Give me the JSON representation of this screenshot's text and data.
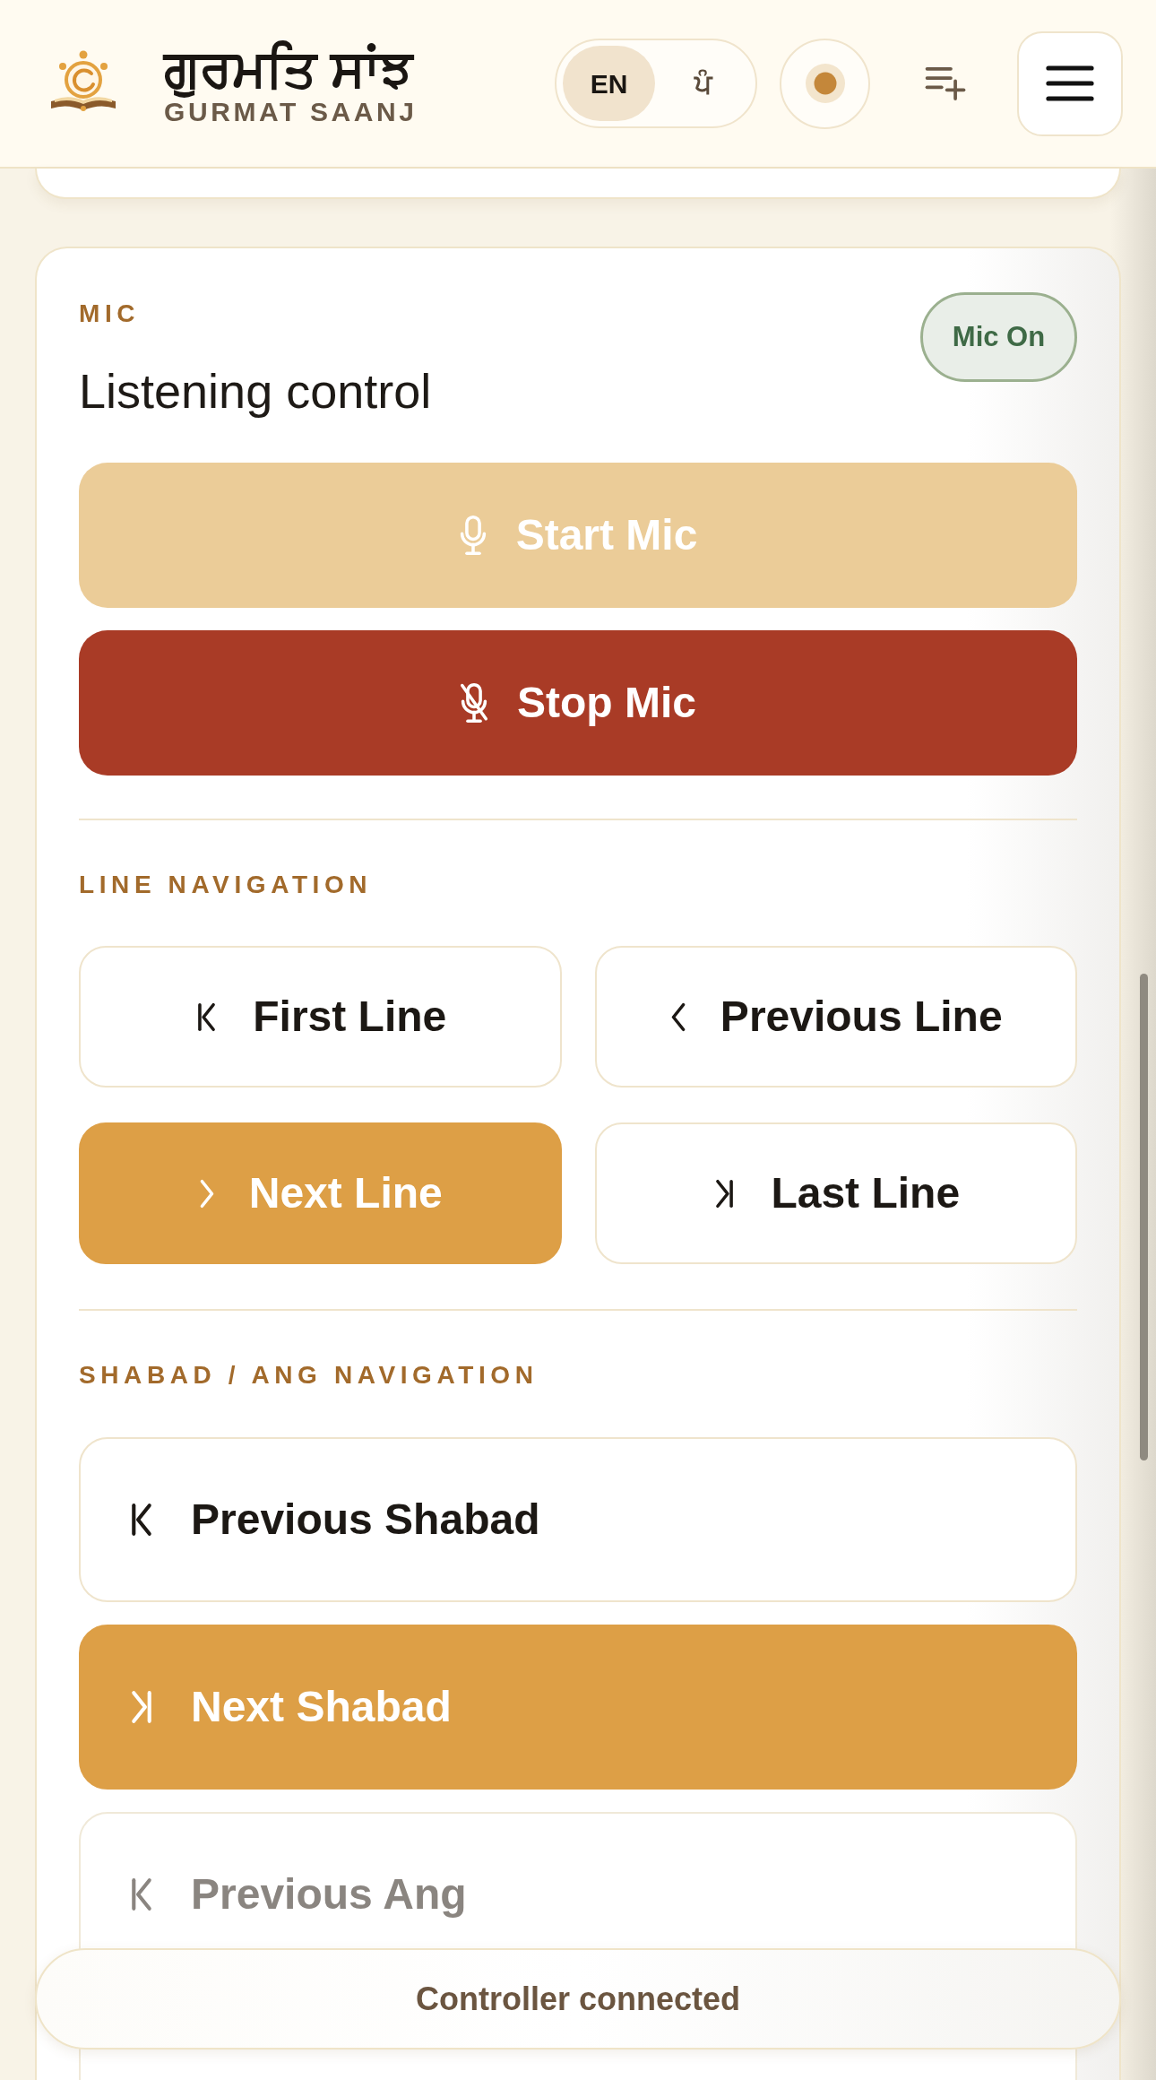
{
  "header": {
    "logo_title": "ਗੁਰਮਤਿ ਸਾਂਝ",
    "logo_subtitle": "GURMAT SAANJ",
    "language_toggle": [
      {
        "label": "EN",
        "selected": true
      },
      {
        "label": "ਪੰ",
        "selected": false
      }
    ]
  },
  "mic_panel": {
    "section_label": "MIC",
    "title": "Listening control",
    "status_badge": {
      "label": "Mic On",
      "on": true
    },
    "buttons": [
      {
        "label": "Start Mic",
        "kind": "start",
        "disabled": true
      },
      {
        "label": "Stop Mic",
        "kind": "stop",
        "disabled": false
      }
    ]
  },
  "line_navigation": {
    "section_label": "LINE NAVIGATION",
    "buttons": [
      {
        "label": "First Line",
        "kind": "first",
        "highlighted": false
      },
      {
        "label": "Previous Line",
        "kind": "previous",
        "highlighted": false
      },
      {
        "label": "Next Line",
        "kind": "next",
        "highlighted": true
      },
      {
        "label": "Last Line",
        "kind": "last",
        "highlighted": false
      }
    ]
  },
  "shabad_ang_navigation": {
    "section_label": "SHABAD / ANG NAVIGATION",
    "buttons": [
      {
        "label": "Previous Shabad",
        "kind": "first",
        "highlighted": false,
        "disabled": false
      },
      {
        "label": "Next Shabad",
        "kind": "last",
        "highlighted": true,
        "disabled": false
      },
      {
        "label": "Previous Ang",
        "kind": "first",
        "highlighted": false,
        "disabled": true
      }
    ]
  },
  "status_toast": {
    "text": "Controller connected"
  }
}
